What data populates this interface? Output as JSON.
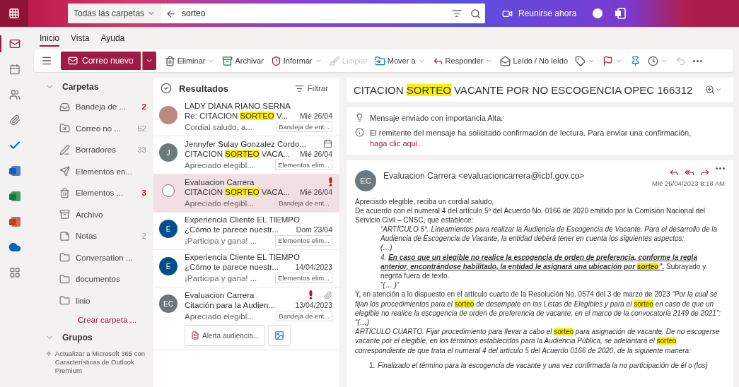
{
  "header": {
    "scope": "Todas las carpetas",
    "query": "sorteo",
    "meet_label": "Reunirse ahora"
  },
  "app_rail": [
    {
      "kind": "mail",
      "selected": true
    },
    {
      "kind": "calendar",
      "selected": false
    },
    {
      "kind": "people",
      "selected": false
    },
    {
      "kind": "files",
      "selected": false
    },
    {
      "kind": "todo",
      "selected": false
    },
    {
      "kind": "word",
      "selected": false
    },
    {
      "kind": "excel",
      "selected": false
    },
    {
      "kind": "powerpoint",
      "selected": false
    },
    {
      "kind": "onedrive",
      "selected": false
    },
    {
      "kind": "apps",
      "selected": false
    }
  ],
  "ribbon_tabs": [
    {
      "label": "Inicio",
      "selected": true
    },
    {
      "label": "Vista",
      "selected": false
    },
    {
      "label": "Ayuda",
      "selected": false
    }
  ],
  "new_mail": "Correo nuevo",
  "toolbar": [
    {
      "kind": "delete",
      "label": "Eliminar",
      "dropdown": true,
      "disabled": false
    },
    {
      "kind": "archive",
      "label": "Archivar",
      "dropdown": false,
      "disabled": false
    },
    {
      "kind": "report",
      "label": "Informar",
      "dropdown": true,
      "disabled": false
    },
    {
      "kind": "sweep",
      "label": "Limpiar",
      "dropdown": false,
      "disabled": true
    },
    {
      "kind": "move",
      "label": "Mover a",
      "dropdown": true,
      "disabled": false
    },
    {
      "kind": "reply",
      "label": "Responder",
      "dropdown": true,
      "disabled": false
    },
    {
      "kind": "read",
      "label": "Leído / No leído",
      "dropdown": false,
      "disabled": false
    },
    {
      "kind": "tag",
      "dropdown": true,
      "disabled": false
    },
    {
      "kind": "flag",
      "dropdown": true,
      "disabled": false
    },
    {
      "kind": "pin",
      "dropdown": false,
      "disabled": false
    },
    {
      "kind": "snooze",
      "dropdown": true,
      "disabled": false
    },
    {
      "kind": "undo",
      "dropdown": false,
      "disabled": true
    },
    {
      "kind": "more",
      "dropdown": false,
      "disabled": false
    }
  ],
  "folders": {
    "title": "Carpetas",
    "items": [
      {
        "kind": "inbox",
        "name": "Bandeja de ...",
        "count": "2",
        "unread": true
      },
      {
        "kind": "junk",
        "name": "Correo no ...",
        "count": "52",
        "unread": false
      },
      {
        "kind": "drafts",
        "name": "Borradores",
        "count": "33",
        "unread": false
      },
      {
        "kind": "sent",
        "name": "Elementos en..."
      },
      {
        "kind": "deleted",
        "name": "Elementos ...",
        "count": "3",
        "unread": true
      },
      {
        "kind": "archive",
        "name": "Archivo"
      },
      {
        "kind": "notes",
        "name": "Notas",
        "count": "2",
        "unread": false
      },
      {
        "kind": "folder",
        "name": "Conversation ..."
      },
      {
        "kind": "folder",
        "name": "documentos"
      },
      {
        "kind": "folder",
        "name": "linio"
      }
    ],
    "create": "Crear carpeta ..."
  },
  "groups": {
    "title": "Grupos"
  },
  "upgrade": "Actualizar a Microsoft 365 con Características de Outlook Premium",
  "results": {
    "title": "Resultados",
    "filter": "Filtrar",
    "messages": [
      {
        "avatar": {
          "kind": "photo"
        },
        "sender": "LADY DIANA RIANO SERNA",
        "subject": [
          {
            "kind": "plain",
            "text": "Re: CITACION "
          },
          {
            "kind": "mark",
            "text": "SORTEO"
          },
          {
            "kind": "plain",
            "text": " V..."
          }
        ],
        "date": "Mié 26/04",
        "preview": "Cordial saludo, a...",
        "folder": "Bandeja de ent...",
        "selected": false,
        "important": false,
        "attachment": false,
        "meeting": false
      },
      {
        "avatar": {
          "kind": "initials",
          "initials": "J",
          "color": "#69797e"
        },
        "sender": "Jennyfer Sulay Gonzalez Cordo...",
        "subject": [
          {
            "kind": "plain",
            "text": "CITACION "
          },
          {
            "kind": "mark",
            "text": "SORTEO"
          },
          {
            "kind": "plain",
            "text": " VACA..."
          }
        ],
        "date": "Mié 26/04",
        "preview": "Apreciado elegibl...",
        "folder": "Elementos elim...",
        "selected": false,
        "important": false,
        "attachment": false,
        "meeting": true
      },
      {
        "avatar": {
          "kind": "select"
        },
        "sender": "Evaluacion Carrera",
        "subject": [
          {
            "kind": "plain",
            "text": "CITACION "
          },
          {
            "kind": "mark",
            "text": "SORTEO"
          },
          {
            "kind": "plain",
            "text": " VACA..."
          }
        ],
        "date": "Mié 26/04",
        "preview": "Apreciado elegibl...",
        "folder": "Bandeja de ent...",
        "selected": true,
        "important": true,
        "attachment": false,
        "meeting": false
      },
      {
        "avatar": {
          "kind": "initials",
          "initials": "E",
          "color": "#004e8c"
        },
        "sender": "Experiencia Cliente EL TIEMPO",
        "subject": [
          {
            "kind": "plain",
            "text": "¿Cómo te parece nuestr..."
          }
        ],
        "date": "Dom 23/04",
        "preview": "¡Participa y gana! ...",
        "folder": "Elementos elim...",
        "selected": false,
        "important": false,
        "attachment": false,
        "meeting": false
      },
      {
        "avatar": {
          "kind": "initials",
          "initials": "E",
          "color": "#004e8c"
        },
        "sender": "Experiencia Cliente EL TIEMPO",
        "subject": [
          {
            "kind": "plain",
            "text": "¿Cómo te parece nuestr..."
          }
        ],
        "date": "14/04/2023",
        "preview": "¡Participa y gana! ...",
        "folder": "Elementos elim...",
        "selected": false,
        "important": false,
        "attachment": false,
        "meeting": false
      },
      {
        "avatar": {
          "kind": "initials",
          "initials": "EC",
          "color": "#69797e"
        },
        "sender": "Evaluacion Carrera",
        "subject": [
          {
            "kind": "plain",
            "text": "Citación para la Audien..."
          }
        ],
        "date": "13/04/2023",
        "preview": "Apreciado elegibl...",
        "folder": "Bandeja de ent...",
        "selected": false,
        "important": true,
        "attachment": true,
        "meeting": false,
        "files": [
          {
            "kind": "document",
            "name": "Alerta audiencia..."
          },
          {
            "kind": "image"
          }
        ]
      }
    ]
  },
  "reading": {
    "subject": [
      {
        "kind": "plain",
        "text": "CITACION "
      },
      {
        "kind": "mark",
        "text": "SORTEO"
      },
      {
        "kind": "plain",
        "text": " VACANTE POR NO ESCOGENCIA OPEC 166312"
      }
    ],
    "notices": [
      {
        "kind": "importance",
        "text": "Mensaje enviado con importancia Alta."
      },
      {
        "kind": "receipt",
        "text": "El remitente del mensaje ha solicitado confirmación de lectura. Para enviar una confirmación,",
        "link": "haga clic aquí."
      }
    ],
    "sender_initials": "EC",
    "sender": "Evaluacion Carrera <evaluacioncarrera@icbf.gov.co>",
    "date": "Mié 26/04/2023 8:18 AM",
    "body": [
      {
        "kind": "para",
        "segments": [
          {
            "kind": "plain",
            "text": "Apreciado elegible, reciba un cordial saludo,"
          }
        ]
      },
      {
        "kind": "para",
        "segments": [
          {
            "kind": "plain",
            "text": "De acuerdo con el numeral 4 del artículo 5º del Acuerdo No. 0166 de 2020 emitido por la Comisión Nacional del Servicio Civil – CNSC, que establece:"
          }
        ]
      },
      {
        "kind": "quote",
        "segments": [
          {
            "kind": "italic",
            "text": "“ARTÍCULO 5°. Lineamientos para realizar la Audiencia de Escogencia de Vacante. Para el desarrollo de la Audiencia de Escogencia de Vacante, la entidad deberá tener en cuenta los siguientes aspectos:"
          }
        ]
      },
      {
        "kind": "quote",
        "segments": [
          {
            "kind": "italic",
            "text": "(…)"
          }
        ]
      },
      {
        "kind": "quote",
        "segments": [
          {
            "kind": "italic",
            "text": "4.  "
          },
          {
            "kind": "strong",
            "text": "En caso que un elegible no realice la escogencia de orden de preferencia, conforme la regla anterior, encontrándose habilitado, la entidad le asignará una ubicación por "
          },
          {
            "kind": "strong_mark",
            "text": "sorteo"
          },
          {
            "kind": "strong",
            "text": "”."
          },
          {
            "kind": "plain",
            "text": " Subrayado y negrita fuera de texto."
          }
        ]
      },
      {
        "kind": "quote",
        "segments": [
          {
            "kind": "italic",
            "text": "“(… )”"
          }
        ]
      },
      {
        "kind": "para",
        "segments": [
          {
            "kind": "plain",
            "text": "Y, en atención a lo dispuesto en el artículo cuarto de la Resolución No. 0574 del 3 de marzo de 2023 "
          },
          {
            "kind": "italic",
            "text": "“Por la cual se fijan los procedimientos para el "
          },
          {
            "kind": "mark",
            "text": "sorteo"
          },
          {
            "kind": "italic",
            "text": " de desempate en las Listas de Elegibles y para el "
          },
          {
            "kind": "mark",
            "text": "sorteo"
          },
          {
            "kind": "italic",
            "text": " en caso de que un elegible no realice la escogencia de orden de preferencia de vacante, en el marco de la convocatoria 2149 de 2021”:"
          }
        ]
      },
      {
        "kind": "para",
        "segments": [
          {
            "kind": "italic",
            "text": "“(…)"
          }
        ]
      },
      {
        "kind": "para",
        "segments": [
          {
            "kind": "italic",
            "text": "ARTÍCULO CUARTO. Fijar procedimiento para llevar a cabo el "
          },
          {
            "kind": "mark",
            "text": "sorteo"
          },
          {
            "kind": "italic",
            "text": " para asignación de vacante. De no escogerse vacante por el elegible, en los términos establecidos para la Audiencia Pública, se adelantará el "
          },
          {
            "kind": "mark",
            "text": "sorteo"
          },
          {
            "kind": "italic",
            "text": " correspondiente de que trata el numeral 4 del artículo 5 del Acuerdo 0166 de 2020, de la siguiente manera:"
          }
        ]
      },
      {
        "kind": "list",
        "number": "1.",
        "segments": [
          {
            "kind": "italic",
            "text": "Finalizado el término para la escogencia de vacante y una vez confirmada la no participación de él o (los)"
          }
        ]
      }
    ]
  }
}
